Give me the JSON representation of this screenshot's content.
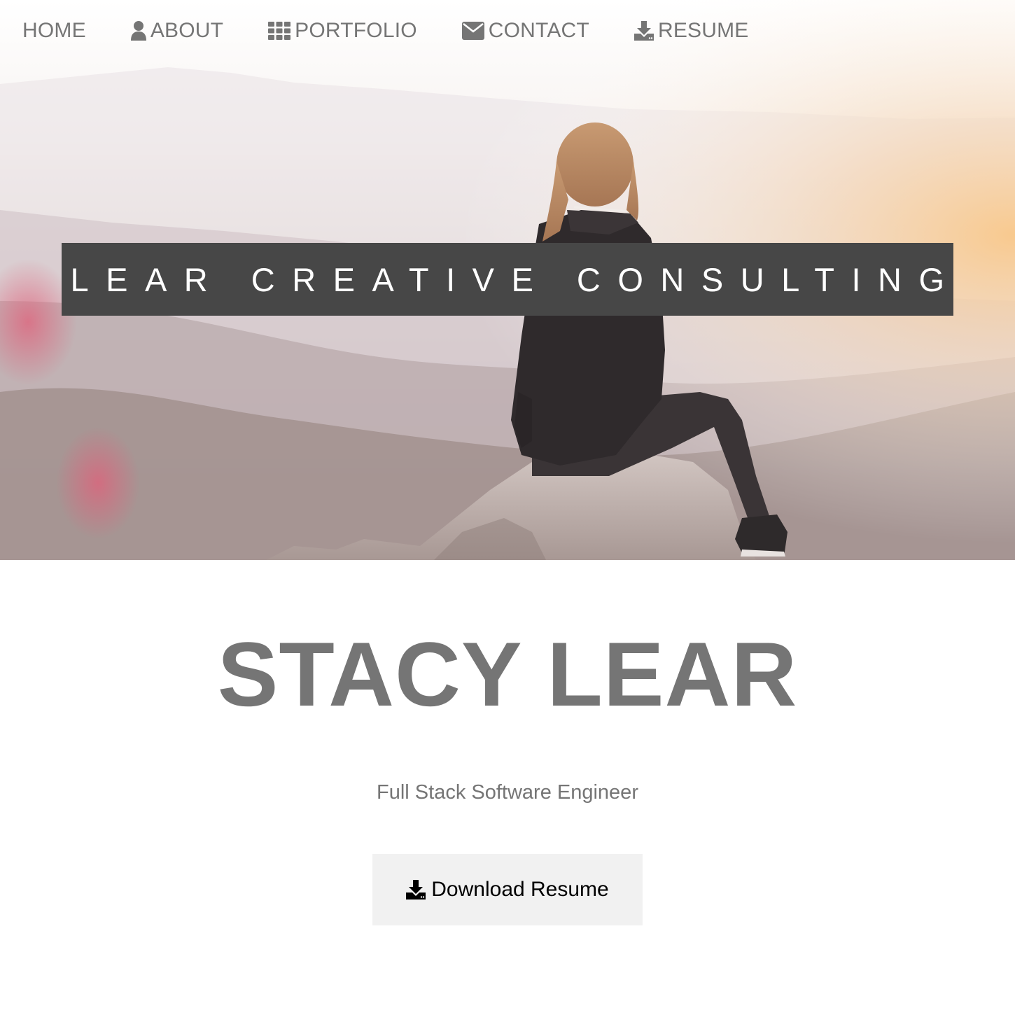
{
  "nav": {
    "items": [
      {
        "label": "HOME",
        "icon": ""
      },
      {
        "label": "ABOUT",
        "icon": "user-icon"
      },
      {
        "label": "PORTFOLIO",
        "icon": "grid-icon"
      },
      {
        "label": "CONTACT",
        "icon": "envelope-icon"
      },
      {
        "label": "RESUME",
        "icon": "download-icon"
      }
    ]
  },
  "hero": {
    "banner_title": "LEAR CREATIVE CONSULTING",
    "image": "woman sitting on mountain rock at sunrise"
  },
  "profile": {
    "name": "STACY LEAR",
    "tagline": "Full Stack Software Engineer"
  },
  "download_button": {
    "label": "Download Resume",
    "icon": "download-icon"
  },
  "colors": {
    "nav_text": "#757575",
    "banner_bg": "#474747",
    "banner_text": "#ffffff",
    "name_text": "#757575",
    "button_bg": "#f1f1f1",
    "button_text": "#000000"
  }
}
